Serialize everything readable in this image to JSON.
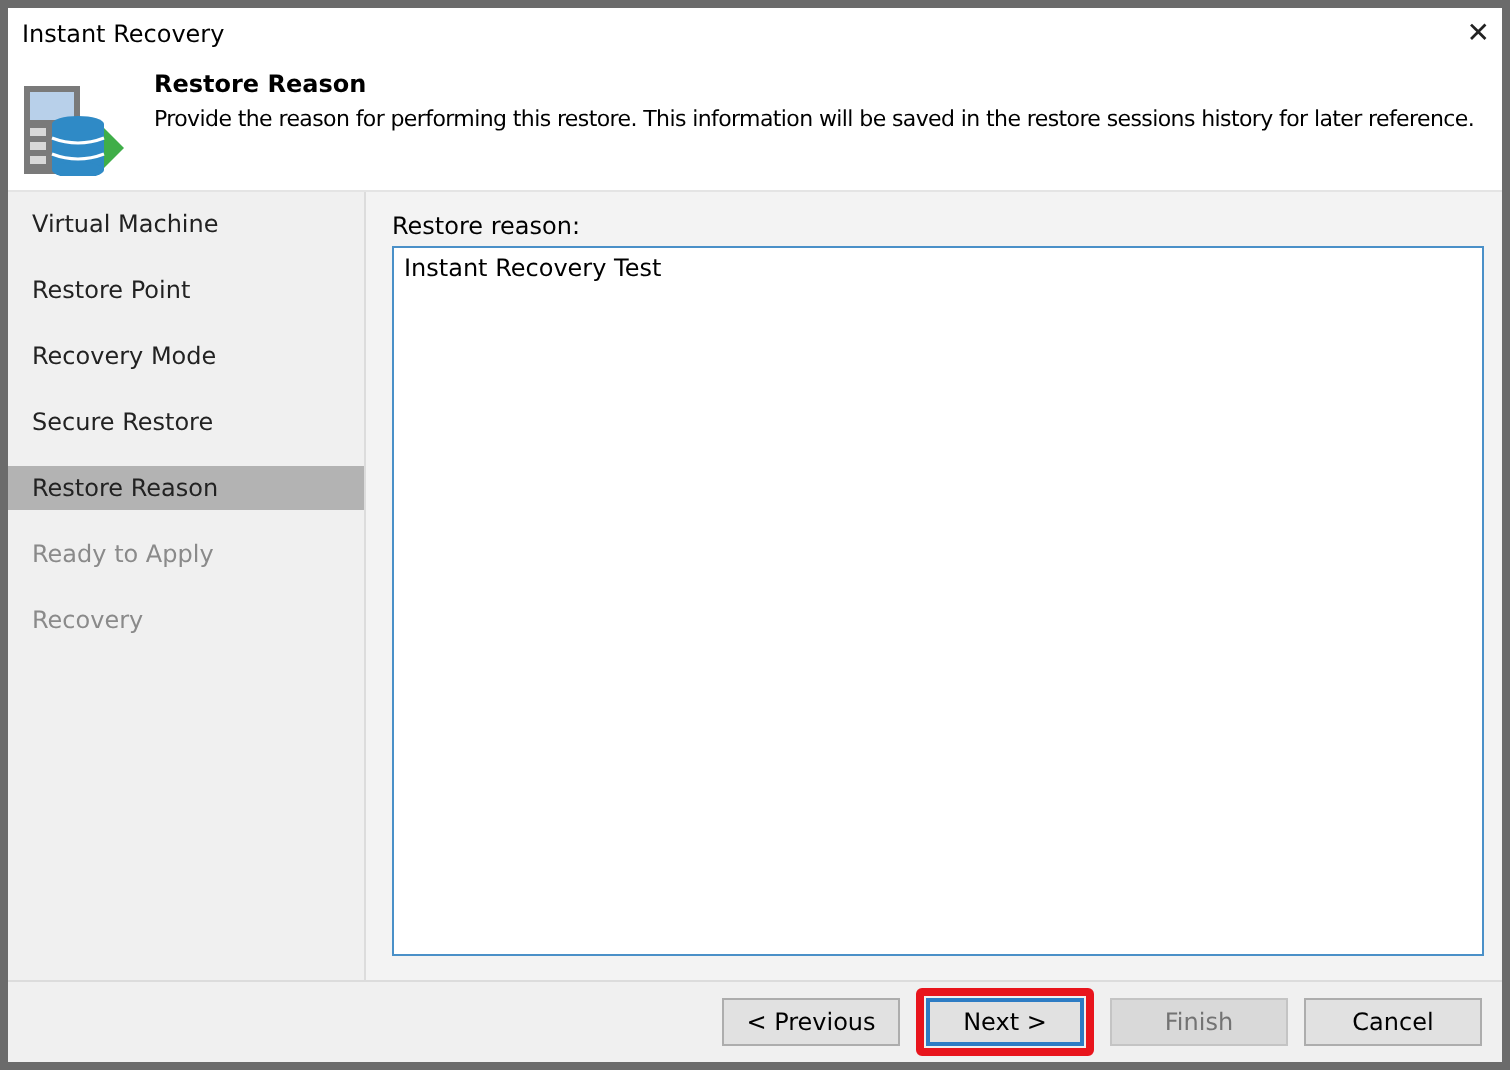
{
  "window": {
    "title": "Instant Recovery",
    "close": "✕"
  },
  "header": {
    "title": "Restore Reason",
    "description": "Provide the reason for performing this restore. This information will be saved in the restore sessions history for later reference."
  },
  "steps": [
    {
      "label": "Virtual Machine",
      "selected": false,
      "disabled": false
    },
    {
      "label": "Restore Point",
      "selected": false,
      "disabled": false
    },
    {
      "label": "Recovery Mode",
      "selected": false,
      "disabled": false
    },
    {
      "label": "Secure Restore",
      "selected": false,
      "disabled": false
    },
    {
      "label": "Restore Reason",
      "selected": true,
      "disabled": false
    },
    {
      "label": "Ready to Apply",
      "selected": false,
      "disabled": true
    },
    {
      "label": "Recovery",
      "selected": false,
      "disabled": true
    }
  ],
  "reason": {
    "label": "Restore reason:",
    "value": "Instant Recovery Test"
  },
  "buttons": [
    {
      "label": "< Previous",
      "disabled": false,
      "highlighted": false
    },
    {
      "label": "Next >",
      "disabled": false,
      "highlighted": true
    },
    {
      "label": "Finish",
      "disabled": true,
      "highlighted": false
    },
    {
      "label": "Cancel",
      "disabled": false,
      "highlighted": false
    }
  ]
}
